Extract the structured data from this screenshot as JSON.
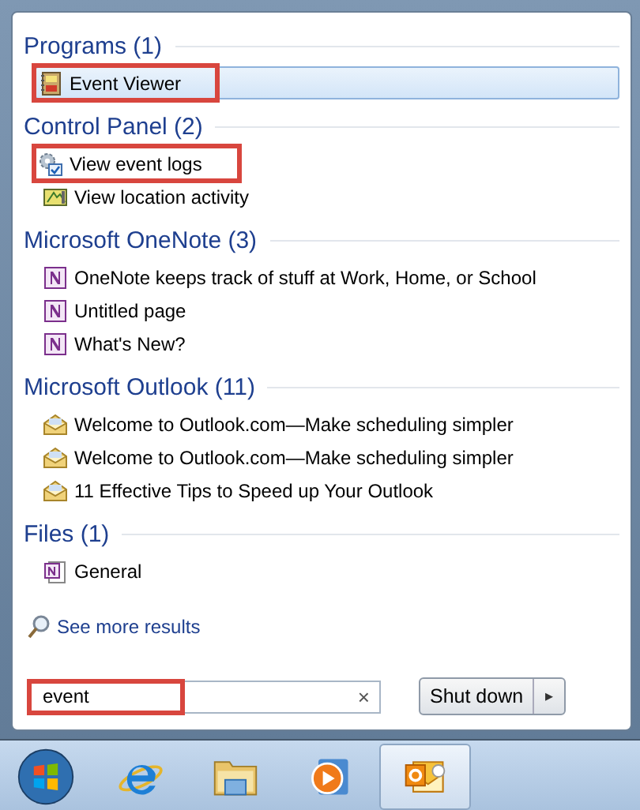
{
  "groups": [
    {
      "heading": "Programs (1)",
      "items": [
        {
          "label": "Event Viewer",
          "kind": "event-viewer",
          "selected": true,
          "annotated": true
        }
      ]
    },
    {
      "heading": "Control Panel (2)",
      "items": [
        {
          "label": "View event logs",
          "kind": "gear-log",
          "selected": false,
          "annotated": true
        },
        {
          "label": "View location activity",
          "kind": "location",
          "selected": false,
          "annotated": false
        }
      ]
    },
    {
      "heading": "Microsoft OneNote (3)",
      "items": [
        {
          "label": "OneNote keeps track of stuff at Work, Home, or School",
          "kind": "onenote",
          "selected": false,
          "annotated": false
        },
        {
          "label": "Untitled page",
          "kind": "onenote",
          "selected": false,
          "annotated": false
        },
        {
          "label": "What's New?",
          "kind": "onenote",
          "selected": false,
          "annotated": false
        }
      ]
    },
    {
      "heading": "Microsoft Outlook (11)",
      "items": [
        {
          "label": "Welcome to Outlook.com—Make scheduling simpler",
          "kind": "mail",
          "selected": false,
          "annotated": false
        },
        {
          "label": "Welcome to Outlook.com—Make scheduling simpler",
          "kind": "mail",
          "selected": false,
          "annotated": false
        },
        {
          "label": "11 Effective Tips to Speed up Your Outlook",
          "kind": "mail",
          "selected": false,
          "annotated": false
        }
      ]
    },
    {
      "heading": "Files (1)",
      "items": [
        {
          "label": "General",
          "kind": "onenote-file",
          "selected": false,
          "annotated": false
        }
      ]
    }
  ],
  "see_more": "See more results",
  "search": {
    "value": "event",
    "annotated": true,
    "clear": "×"
  },
  "shutdown": {
    "label": "Shut down",
    "arrow": "▸"
  },
  "taskbar": [
    {
      "kind": "start",
      "selected": false
    },
    {
      "kind": "browser",
      "selected": false
    },
    {
      "kind": "folder",
      "selected": false
    },
    {
      "kind": "media",
      "selected": false
    },
    {
      "kind": "mail-app",
      "selected": true
    }
  ]
}
